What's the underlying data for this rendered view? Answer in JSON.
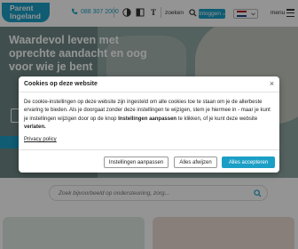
{
  "header": {
    "logo_line1": "Parent",
    "logo_line2": "Ingeland",
    "phone": "088 307 2000",
    "search_label": "zoeken",
    "login_label": "Inloggen",
    "menu_label": "menu",
    "font_tool": "T"
  },
  "hero": {
    "title": "Waardevol leven met oprechte aandacht en oog voor wie je bent"
  },
  "search": {
    "placeholder": "Zoek bijvoorbeeld op ondersteuning, zorg..."
  },
  "cookie_modal": {
    "title": "Cookies op deze website",
    "close": "×",
    "body_part1": "De cookie-instellingen op deze website zijn ingesteld om alle cookies toe te staan om je de allerbeste ervaring te bieden. Als je doorgaat zonder deze instellingen te wijzigen, stem je hiermee in - maar je kunt je instellingen wijzigen door op de knop ",
    "body_bold1": "Instellingen aanpassen",
    "body_part2": " te klikken, of je kunt deze website ",
    "body_bold2": "verlaten.",
    "privacy_label": "Privacy policy",
    "btn_settings": "Instellingen aanpassen",
    "btn_reject": "Alles afwijzen",
    "btn_accept": "Alles accepteren"
  },
  "colors": {
    "brand": "#1b9fc6",
    "overlay": "rgba(0,0,0,0.42)"
  },
  "icons": {
    "phone": "phone-icon",
    "contrast": "contrast-icon",
    "grayscale": "grayscale-icon",
    "font_size": "font-size-icon",
    "search": "search-icon",
    "chevron": "chevron-down-icon",
    "flag": "dutch-flag-icon",
    "menu": "hamburger-icon",
    "close": "close-icon"
  }
}
